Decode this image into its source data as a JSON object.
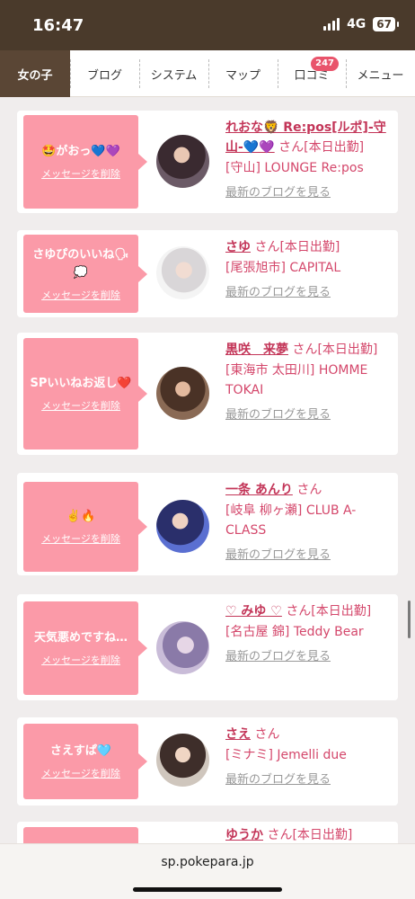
{
  "status_bar": {
    "time": "16:47",
    "network": "4G",
    "battery": "67"
  },
  "nav": {
    "tabs": [
      {
        "label": "女の子",
        "active": true
      },
      {
        "label": "ブログ"
      },
      {
        "label": "システム"
      },
      {
        "label": "マップ"
      },
      {
        "label": "口コミ",
        "badge": "247"
      },
      {
        "label": "メニュー"
      }
    ]
  },
  "delete_label": "メッセージを削除",
  "blog_label": "最新のブログを見る",
  "san_label": "さん",
  "cards": [
    {
      "message": "🤩がおっ💙💜",
      "name": "れおな🦁 Re:pos[ルポ]-守山-💙💜",
      "status": "さん[本日出勤]",
      "location": "[守山] LOUNGE Re:pos"
    },
    {
      "message": "さゆぴのいいね🗣💭",
      "name": "さゆ",
      "status": "さん[本日出勤]",
      "location": "[尾張旭市] CAPITAL"
    },
    {
      "message": "SPいいねお返し❤️",
      "name": "黒咲　来夢",
      "status": "さん[本日出勤]",
      "location": "[東海市 太田川] HOMME TOKAI"
    },
    {
      "message": "✌️🔥",
      "name": "一条 あんり",
      "status": "さん",
      "location": "[岐阜 柳ヶ瀬] CLUB A-CLASS"
    },
    {
      "message": "天気悪めですね…",
      "name": "♡ みゆ ♡",
      "status": "さん[本日出勤]",
      "location": "[名古屋 錦] Teddy Bear"
    },
    {
      "message": "さえすぱ🩵",
      "name": "さえ",
      "status": "さん",
      "location": "[ミナミ] Jemelli due"
    },
    {
      "message": "",
      "name": "ゆうか",
      "status": "さん[本日出勤]",
      "location": ""
    }
  ],
  "url": "sp.pokepara.jp",
  "colors": {
    "accent": "#c33558",
    "bubble": "#fb9aa8",
    "nav_active": "#5a4635",
    "status_bar": "#4a3a2b",
    "badge": "#e9546b"
  }
}
